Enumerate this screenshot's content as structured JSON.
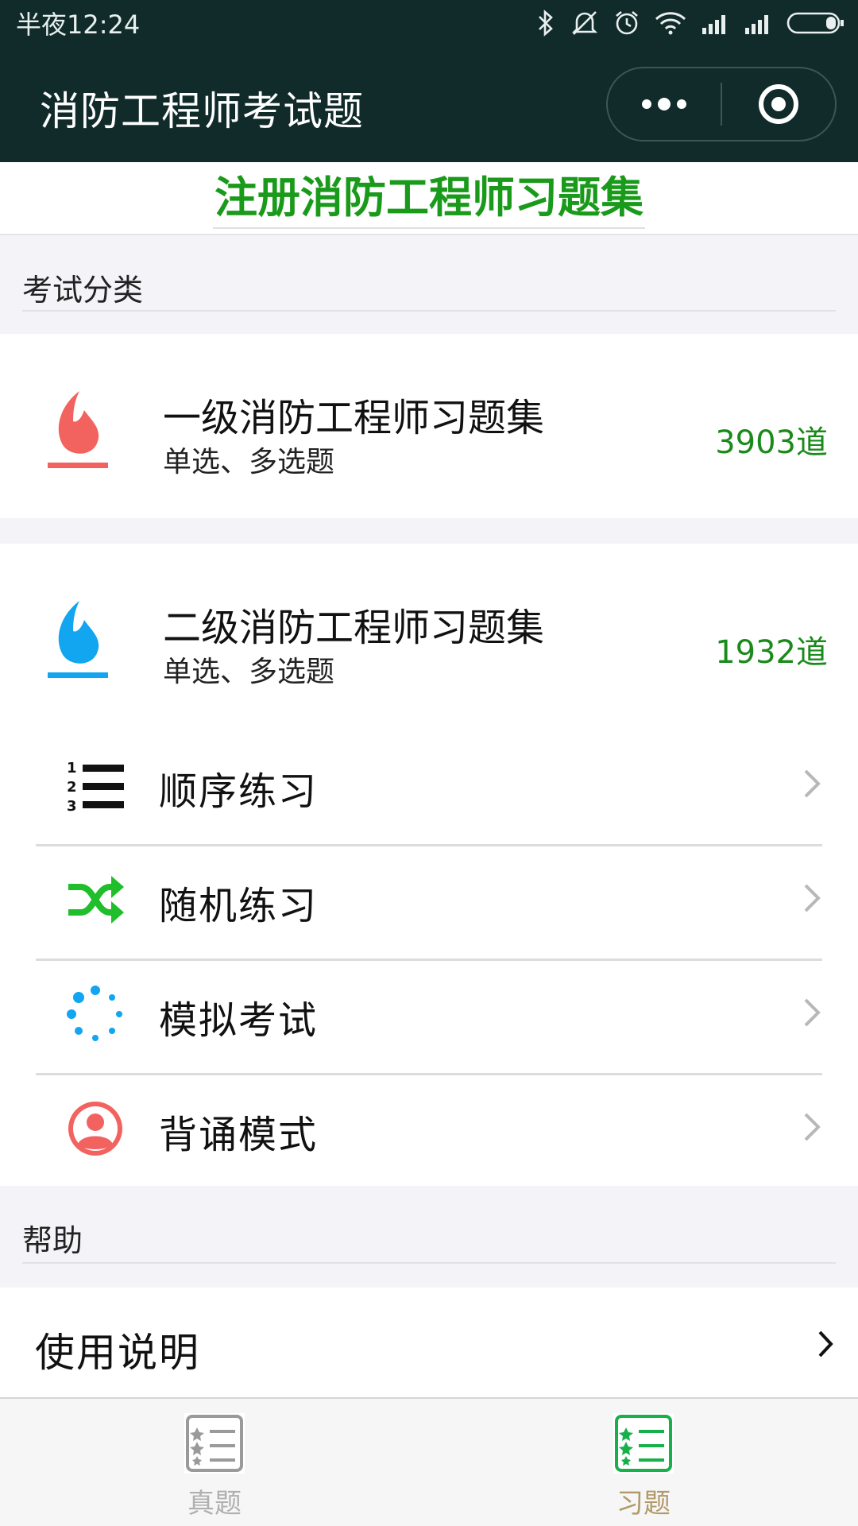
{
  "status_bar": {
    "time": "半夜12:24",
    "icons": [
      "bluetooth-icon",
      "mute-icon",
      "alarm-icon",
      "wifi-icon",
      "signal-icon",
      "signal-icon",
      "battery-icon"
    ]
  },
  "header": {
    "title": "消防工程师考试题",
    "more_icon": "more-dots-icon",
    "close_icon": "target-circle-icon"
  },
  "banner": {
    "title": "注册消防工程师习题集"
  },
  "sections": {
    "exam_category": "考试分类",
    "help": "帮助"
  },
  "exams": [
    {
      "title": "一级消防工程师习题集",
      "subtitle": "单选、多选题",
      "count": "3903道",
      "icon": "flame-icon",
      "color": "#f2635f"
    },
    {
      "title": "二级消防工程师习题集",
      "subtitle": "单选、多选题",
      "count": "1932道",
      "icon": "flame-icon",
      "color": "#12a5f0"
    }
  ],
  "menu": [
    {
      "label": "顺序练习",
      "icon": "numbered-list-icon"
    },
    {
      "label": "随机练习",
      "icon": "shuffle-icon"
    },
    {
      "label": "模拟考试",
      "icon": "dotted-circle-icon"
    },
    {
      "label": "背诵模式",
      "icon": "user-avatar-icon"
    }
  ],
  "help_items": [
    {
      "label": "使用说明"
    }
  ],
  "tabs": [
    {
      "label": "真题",
      "icon": "checklist-icon",
      "active": false
    },
    {
      "label": "习题",
      "icon": "checklist-icon",
      "active": true
    }
  ],
  "colors": {
    "header_bg": "#112b2b",
    "accent_green": "#1a9a1a",
    "tab_active_icon": "#18b04a",
    "tab_active_label": "#b19a6a",
    "tab_inactive": "#9a9a9a"
  }
}
